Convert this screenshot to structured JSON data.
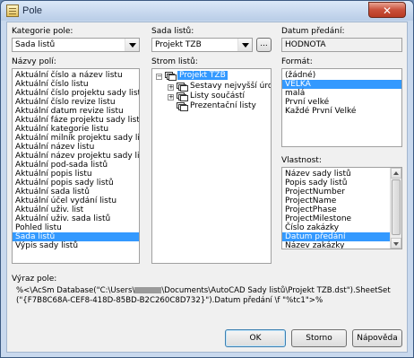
{
  "window": {
    "title": "Pole",
    "close_label": "✕"
  },
  "kategorie": {
    "label": "Kategorie pole:",
    "value": "Sada listů"
  },
  "nazvy": {
    "label": "Názvy polí:",
    "items": [
      "Aktuální číslo a název listu",
      "Aktuální číslo listu",
      "Aktuální číslo projektu sady listů",
      "Aktuální číslo revize listu",
      "Aktuální datum revize listu",
      "Aktuální fáze projektu sady listů",
      "Aktuální kategorie listu",
      "Aktuální milník projektu sady listů",
      "Aktuální název listu",
      "Aktuální název projektu sady listů",
      "Aktuální pod-sada listů",
      "Aktuální popis listu",
      "Aktuální popis sady listů",
      "Aktuální sada listů",
      "Aktuální účel vydání listu",
      "Aktuální uživ. list",
      "Aktuální uživ. sada listů",
      "Pohled listu",
      "Sada listů",
      "Výpis sady listů"
    ],
    "selected": "Sada listů"
  },
  "sada": {
    "label": "Sada listů:",
    "value": "Projekt TZB",
    "browse_label": "..."
  },
  "strom": {
    "label": "Strom listů:",
    "root": "Projekt TZB",
    "children": [
      "Sestavy nejvyšší úrovn",
      "Listy součástí",
      "Prezentační listy"
    ]
  },
  "datum": {
    "label": "Datum předání:",
    "value": "HODNOTA"
  },
  "format": {
    "label": "Formát:",
    "items": [
      "(žádné)",
      "VELKÁ",
      "malá",
      "První velké",
      "Každé První Velké"
    ],
    "selected": "VELKÁ"
  },
  "vlastnost": {
    "label": "Vlastnost:",
    "items": [
      "Název sady listů",
      "Popis sady listů",
      "ProjectNumber",
      "ProjectName",
      "ProjectPhase",
      "ProjectMilestone",
      "Číslo zakázky",
      "Datum předání",
      "Název zakázky"
    ],
    "selected": "Datum předání"
  },
  "vyraz": {
    "label": "Výraz pole:",
    "line1": "%<\\AcSm Database(\"C:\\Users\\",
    "line1b": "\\Documents\\AutoCAD Sady listů\\Projekt TZB.dst\").SheetSet",
    "line2": "(\"{F7B8C68A-CEF8-418D-85BD-B2C260C8D732}\").Datum předání \\f \"%tc1\">%"
  },
  "buttons": {
    "ok": "OK",
    "storno": "Storno",
    "napoveda": "Nápověda"
  },
  "colors": {
    "selection": "#3399ff",
    "close": "#c9503a"
  }
}
